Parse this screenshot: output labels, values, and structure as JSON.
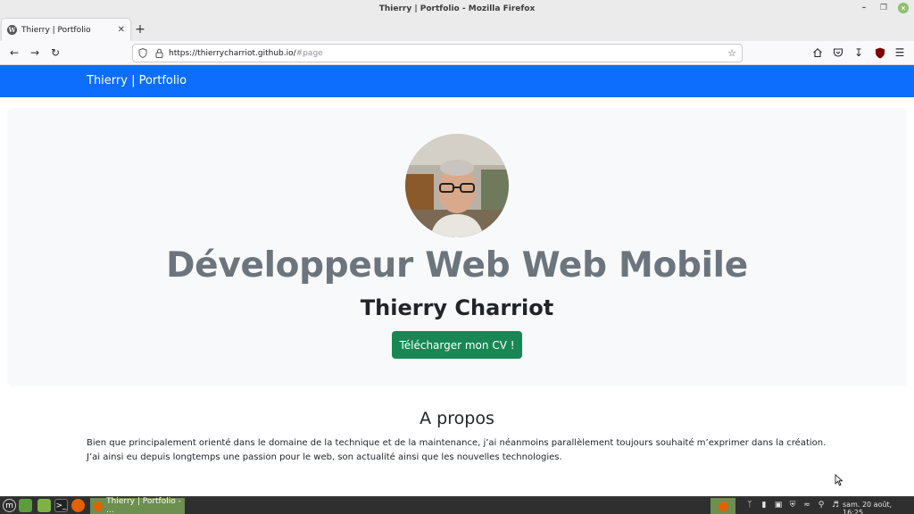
{
  "window": {
    "title": "Thierry | Portfolio - Mozilla Firefox"
  },
  "tabs": [
    {
      "label": "Thierry | Portfolio",
      "favicon": "wordpress-icon"
    }
  ],
  "toolbar": {
    "url_host": "https://thierrycharriot.github.io/",
    "url_path": "#page"
  },
  "site": {
    "brand": "Thierry | Portfolio",
    "hero": {
      "title": "Développeur Web Web Mobile",
      "name": "Thierry Charriot",
      "cv_button": "Télécharger mon CV !"
    },
    "about": {
      "title": "A propos",
      "line1": "Bien que principalement orienté dans le domaine de la technique et de la maintenance, j’ai néanmoins parallèlement toujours souhaité m’exprimer dans la création.",
      "line2": "J’ai ainsi eu depuis longtemps une passion pour le web, son actualité ainsi que les nouvelles technologies."
    }
  },
  "taskbar": {
    "task_label": "Thierry | Portfolio - ...",
    "clock": "sam. 20 août, 16:25"
  },
  "colors": {
    "navbar": "#0d6efd",
    "hero_bg": "#f8f9fa",
    "button": "#198754",
    "title_gray": "#6c757d"
  }
}
